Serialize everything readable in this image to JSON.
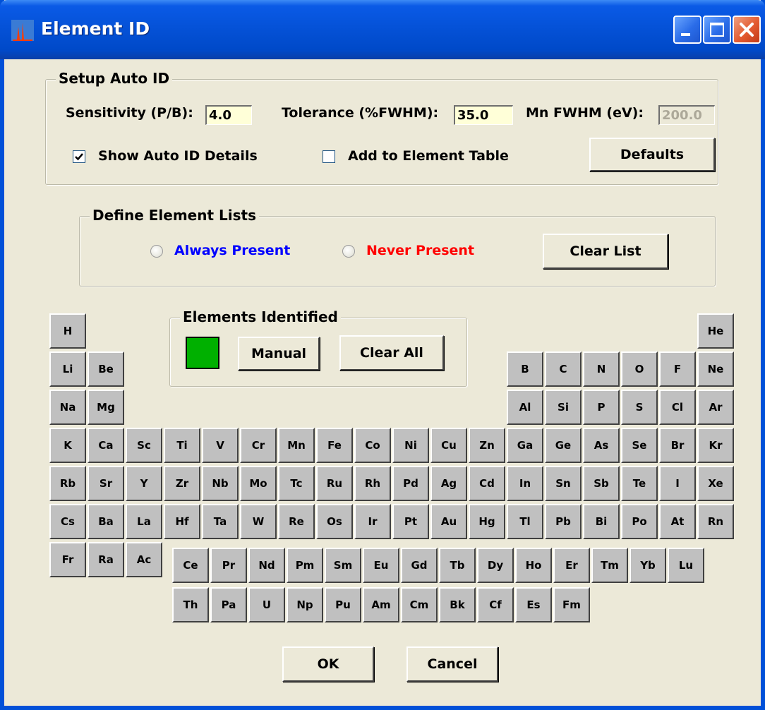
{
  "window": {
    "title": "Element ID"
  },
  "colors": {
    "always_present": "#0000ff",
    "never_present": "#ff0000",
    "identified_swatch": "#00b000"
  },
  "setup": {
    "legend": "Setup Auto ID",
    "sensitivity_label": "Sensitivity (P/B):",
    "sensitivity_value": "4.0",
    "tolerance_label": "Tolerance (%FWHM):",
    "tolerance_value": "35.0",
    "mnfwhm_label": "Mn FWHM (eV):",
    "mnfwhm_value": "200.0",
    "show_details_label": "Show Auto ID Details",
    "show_details_checked": true,
    "add_table_label": "Add to Element Table",
    "add_table_checked": false,
    "defaults_label": "Defaults"
  },
  "lists": {
    "legend": "Define Element Lists",
    "always_label": "Always Present",
    "never_label": "Never Present",
    "clear_label": "Clear List"
  },
  "identified": {
    "legend": "Elements Identified",
    "manual_label": "Manual",
    "clear_all_label": "Clear All"
  },
  "elements": {
    "main": [
      [
        "H",
        null,
        null,
        null,
        null,
        null,
        null,
        null,
        null,
        null,
        null,
        null,
        null,
        null,
        null,
        null,
        null,
        "He"
      ],
      [
        "Li",
        "Be",
        null,
        null,
        null,
        null,
        null,
        null,
        null,
        null,
        null,
        null,
        "B",
        "C",
        "N",
        "O",
        "F",
        "Ne"
      ],
      [
        "Na",
        "Mg",
        null,
        null,
        null,
        null,
        null,
        null,
        null,
        null,
        null,
        null,
        "Al",
        "Si",
        "P",
        "S",
        "Cl",
        "Ar"
      ],
      [
        "K",
        "Ca",
        "Sc",
        "Ti",
        "V",
        "Cr",
        "Mn",
        "Fe",
        "Co",
        "Ni",
        "Cu",
        "Zn",
        "Ga",
        "Ge",
        "As",
        "Se",
        "Br",
        "Kr"
      ],
      [
        "Rb",
        "Sr",
        "Y",
        "Zr",
        "Nb",
        "Mo",
        "Tc",
        "Ru",
        "Rh",
        "Pd",
        "Ag",
        "Cd",
        "In",
        "Sn",
        "Sb",
        "Te",
        "I",
        "Xe"
      ],
      [
        "Cs",
        "Ba",
        "La",
        "Hf",
        "Ta",
        "W",
        "Re",
        "Os",
        "Ir",
        "Pt",
        "Au",
        "Hg",
        "Tl",
        "Pb",
        "Bi",
        "Po",
        "At",
        "Rn"
      ],
      [
        "Fr",
        "Ra",
        "Ac"
      ]
    ],
    "lanthanides": [
      "Ce",
      "Pr",
      "Nd",
      "Pm",
      "Sm",
      "Eu",
      "Gd",
      "Tb",
      "Dy",
      "Ho",
      "Er",
      "Tm",
      "Yb",
      "Lu"
    ],
    "actinides": [
      "Th",
      "Pa",
      "U",
      "Np",
      "Pu",
      "Am",
      "Cm",
      "Bk",
      "Cf",
      "Es",
      "Fm"
    ]
  },
  "footer": {
    "ok_label": "OK",
    "cancel_label": "Cancel"
  }
}
